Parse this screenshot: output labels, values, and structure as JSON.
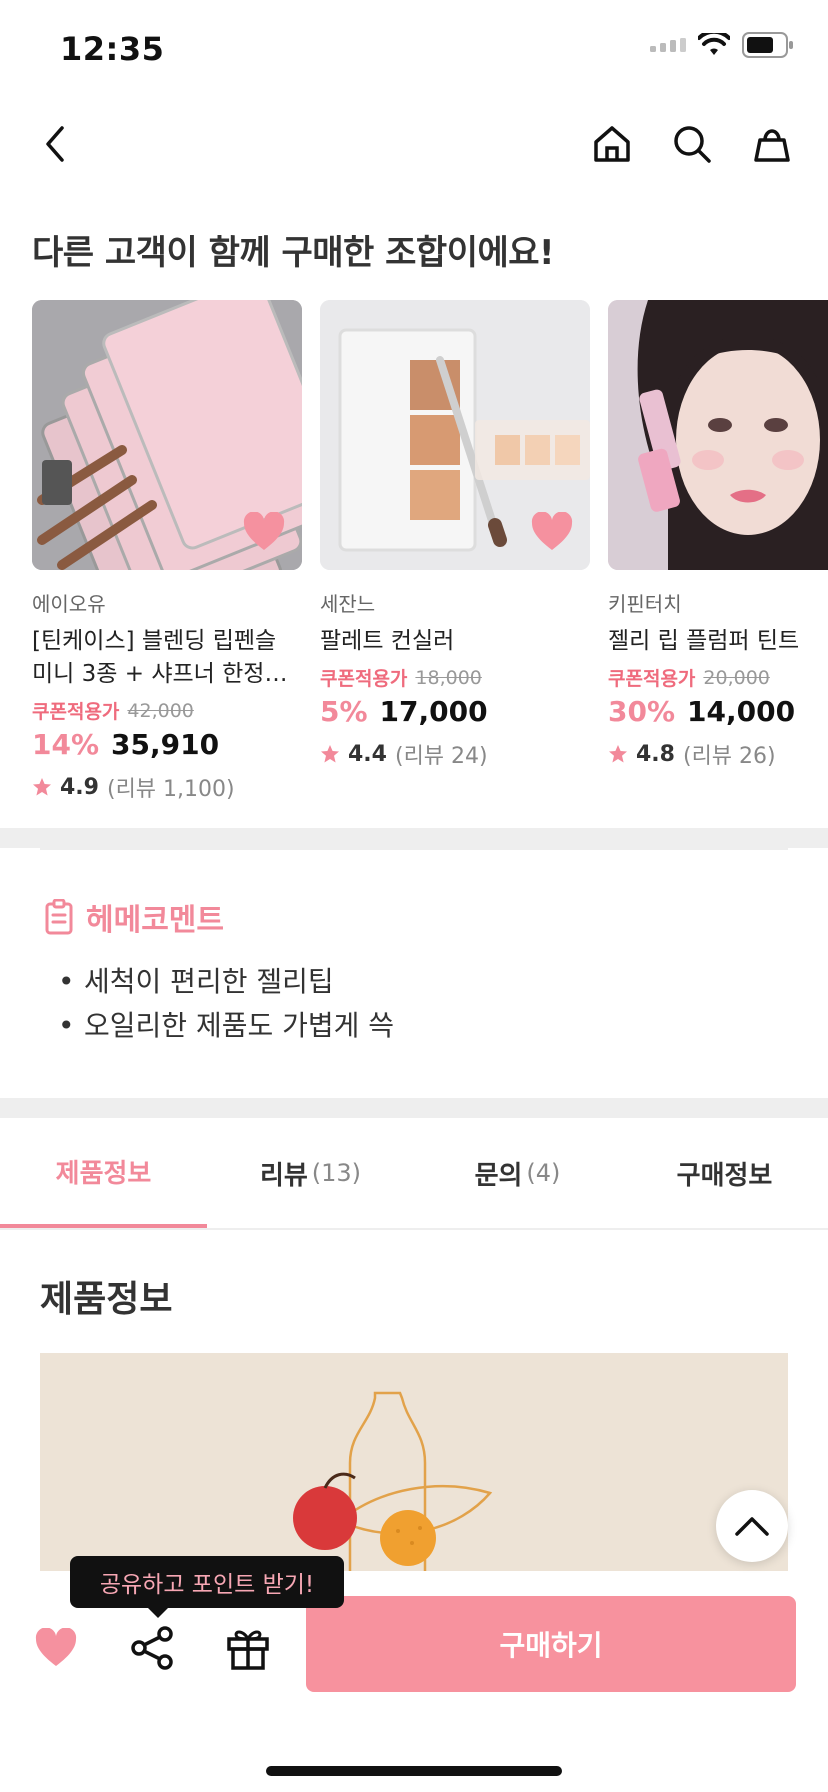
{
  "status": {
    "time": "12:35"
  },
  "nav": {
    "icons": [
      "back-icon",
      "home-icon",
      "search-icon",
      "cart-icon"
    ]
  },
  "recommend": {
    "title": "다른 고객이 함께 구매한 조합이에요!",
    "items": [
      {
        "brand": "에이오유",
        "name": "[틴케이스] 블렌딩 립펜슬 미니 3종 + 샤프너 한정기획…",
        "coupon_label": "쿠폰적용가",
        "original_price": "42,000",
        "discount": "14%",
        "price": "35,910",
        "rating": "4.9",
        "reviews": "(리뷰 1,100)"
      },
      {
        "brand": "세잔느",
        "name": "팔레트 컨실러",
        "coupon_label": "쿠폰적용가",
        "original_price": "18,000",
        "discount": "5%",
        "price": "17,000",
        "rating": "4.4",
        "reviews": "(리뷰 24)"
      },
      {
        "brand": "키핀터치",
        "name": "젤리 립 플럼퍼 틴트",
        "coupon_label": "쿠폰적용가",
        "original_price": "20,000",
        "discount": "30%",
        "price": "14,000",
        "rating": "4.8",
        "reviews": "(리뷰 26)"
      }
    ]
  },
  "comment": {
    "title": "헤메코멘트",
    "items": [
      "세척이 편리한 젤리팁",
      "오일리한 제품도 가볍게 쓱"
    ]
  },
  "tabs": [
    {
      "label": "제품정보",
      "count": "",
      "active": true
    },
    {
      "label": "리뷰",
      "count": "(13)",
      "active": false
    },
    {
      "label": "문의",
      "count": "(4)",
      "active": false
    },
    {
      "label": "구매정보",
      "count": "",
      "active": false
    }
  ],
  "product_info": {
    "title": "제품정보"
  },
  "tooltip": "공유하고 포인트 받기!",
  "bottom": {
    "buy_label": "구매하기"
  },
  "colors": {
    "accent": "#f2899a",
    "buy_button": "#f7929e",
    "coupon": "#ef6b7d"
  }
}
